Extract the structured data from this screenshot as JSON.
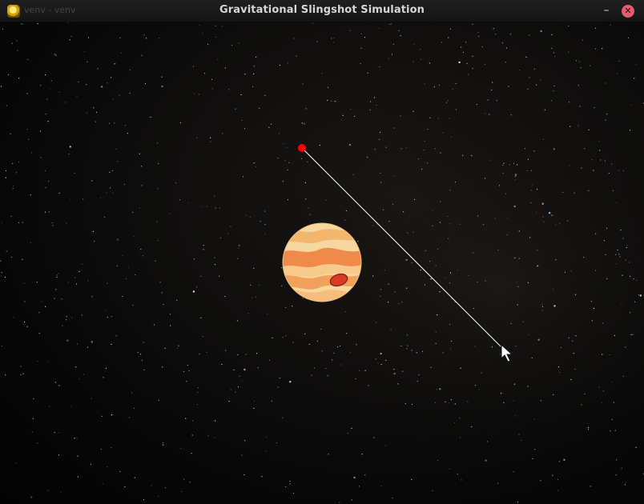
{
  "window": {
    "title": "Gravitational Slingshot Simulation",
    "background_title": "venv - venv",
    "controls": {
      "minimize_glyph": "–",
      "close_glyph": "✕"
    }
  },
  "scene": {
    "planet": "jupiter-icon",
    "projectile_color": "#ff0000",
    "aim_line_color": "#ffffff",
    "cursor": "arrow-cursor-icon"
  },
  "colors": {
    "titlebar": "#1b1b1b",
    "space": "#0b0b0b",
    "close_button": "#e35d6a",
    "planet_light": "#f7d7a0",
    "planet_band": "#f08a4b",
    "great_red_spot": "#d93a25"
  }
}
